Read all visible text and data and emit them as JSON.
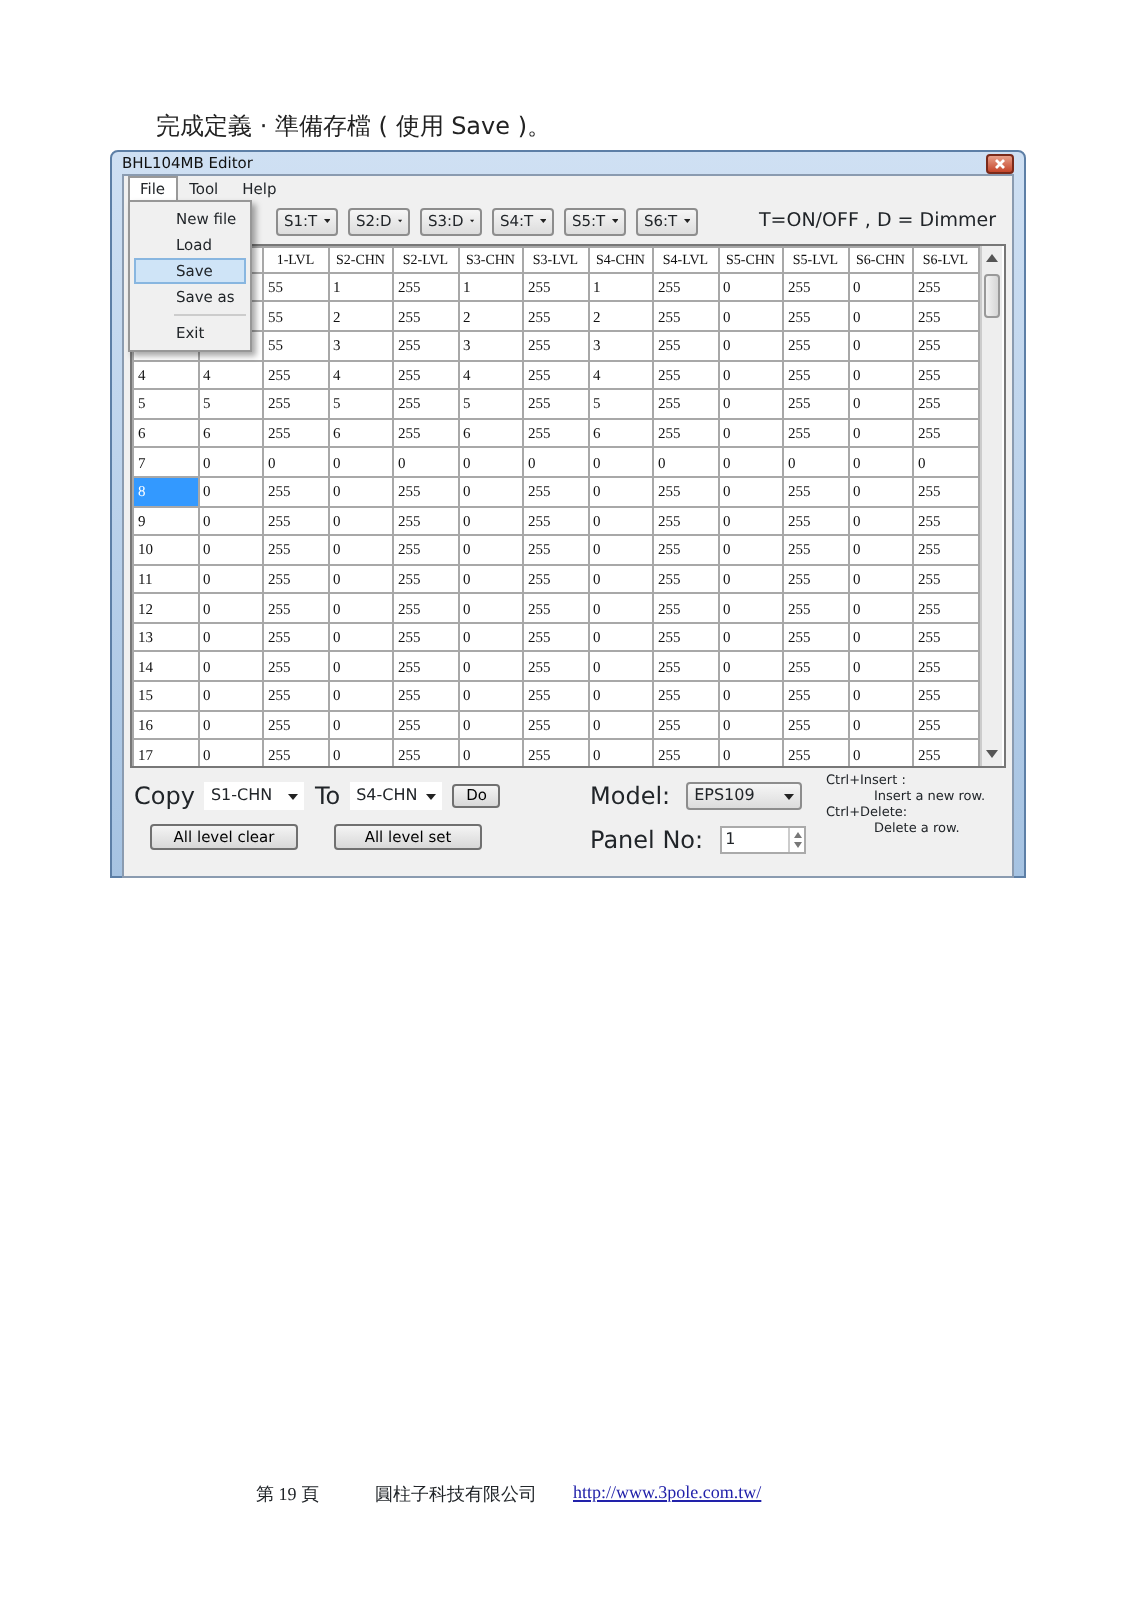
{
  "caption": "完成定義 · 準備存檔 ( 使用 Save )。",
  "window": {
    "title": "BHL104MB Editor",
    "menu": [
      {
        "label": "File",
        "selected": true
      },
      {
        "label": "Tool",
        "selected": false
      },
      {
        "label": "Help",
        "selected": false
      }
    ],
    "file_menu": [
      {
        "kind": "item",
        "label": "New file",
        "selected": false
      },
      {
        "kind": "item",
        "label": "Load",
        "selected": false
      },
      {
        "kind": "item",
        "label": "Save",
        "selected": true
      },
      {
        "kind": "item",
        "label": "Save as",
        "selected": false
      },
      {
        "kind": "separator"
      },
      {
        "kind": "item",
        "label": "Exit",
        "selected": false
      }
    ],
    "slots": [
      "S1:T",
      "S2:D",
      "S3:D",
      "S4:T",
      "S5:T",
      "S6:T"
    ],
    "legend": "T=ON/OFF , D = Dimmer",
    "table": {
      "columns": [
        null,
        null,
        "1-LVL",
        "S2-CHN",
        "S2-LVL",
        "S3-CHN",
        "S3-LVL",
        "S4-CHN",
        "S4-LVL",
        "S5-CHN",
        "S5-LVL",
        "S6-CHN",
        "S6-LVL"
      ],
      "rows": [
        {
          "selected": false,
          "cells": [
            null,
            null,
            "55",
            "1",
            "255",
            "1",
            "255",
            "1",
            "255",
            "0",
            "255",
            "0",
            "255"
          ]
        },
        {
          "selected": false,
          "cells": [
            null,
            null,
            "55",
            "2",
            "255",
            "2",
            "255",
            "2",
            "255",
            "0",
            "255",
            "0",
            "255"
          ]
        },
        {
          "selected": false,
          "cells": [
            null,
            null,
            "55",
            "3",
            "255",
            "3",
            "255",
            "3",
            "255",
            "0",
            "255",
            "0",
            "255"
          ]
        },
        {
          "selected": false,
          "cells": [
            "4",
            "4",
            "255",
            "4",
            "255",
            "4",
            "255",
            "4",
            "255",
            "0",
            "255",
            "0",
            "255"
          ]
        },
        {
          "selected": false,
          "cells": [
            "5",
            "5",
            "255",
            "5",
            "255",
            "5",
            "255",
            "5",
            "255",
            "0",
            "255",
            "0",
            "255"
          ]
        },
        {
          "selected": false,
          "cells": [
            "6",
            "6",
            "255",
            "6",
            "255",
            "6",
            "255",
            "6",
            "255",
            "0",
            "255",
            "0",
            "255"
          ]
        },
        {
          "selected": false,
          "cells": [
            "7",
            "0",
            "0",
            "0",
            "0",
            "0",
            "0",
            "0",
            "0",
            "0",
            "0",
            "0",
            "0"
          ]
        },
        {
          "selected": true,
          "cells": [
            "8",
            "0",
            "255",
            "0",
            "255",
            "0",
            "255",
            "0",
            "255",
            "0",
            "255",
            "0",
            "255"
          ]
        },
        {
          "selected": false,
          "cells": [
            "9",
            "0",
            "255",
            "0",
            "255",
            "0",
            "255",
            "0",
            "255",
            "0",
            "255",
            "0",
            "255"
          ]
        },
        {
          "selected": false,
          "cells": [
            "10",
            "0",
            "255",
            "0",
            "255",
            "0",
            "255",
            "0",
            "255",
            "0",
            "255",
            "0",
            "255"
          ]
        },
        {
          "selected": false,
          "cells": [
            "11",
            "0",
            "255",
            "0",
            "255",
            "0",
            "255",
            "0",
            "255",
            "0",
            "255",
            "0",
            "255"
          ]
        },
        {
          "selected": false,
          "cells": [
            "12",
            "0",
            "255",
            "0",
            "255",
            "0",
            "255",
            "0",
            "255",
            "0",
            "255",
            "0",
            "255"
          ]
        },
        {
          "selected": false,
          "cells": [
            "13",
            "0",
            "255",
            "0",
            "255",
            "0",
            "255",
            "0",
            "255",
            "0",
            "255",
            "0",
            "255"
          ]
        },
        {
          "selected": false,
          "cells": [
            "14",
            "0",
            "255",
            "0",
            "255",
            "0",
            "255",
            "0",
            "255",
            "0",
            "255",
            "0",
            "255"
          ]
        },
        {
          "selected": false,
          "cells": [
            "15",
            "0",
            "255",
            "0",
            "255",
            "0",
            "255",
            "0",
            "255",
            "0",
            "255",
            "0",
            "255"
          ]
        },
        {
          "selected": false,
          "cells": [
            "16",
            "0",
            "255",
            "0",
            "255",
            "0",
            "255",
            "0",
            "255",
            "0",
            "255",
            "0",
            "255"
          ]
        },
        {
          "selected": false,
          "cells": [
            "17",
            "0",
            "255",
            "0",
            "255",
            "0",
            "255",
            "0",
            "255",
            "0",
            "255",
            "0",
            "255"
          ]
        }
      ]
    },
    "copy_label": "Copy",
    "copy_from": "S1-CHN",
    "to_label": "To",
    "copy_to": "S4-CHN",
    "do_button": "Do",
    "model_label": "Model:",
    "model": "EPS109",
    "panel_label": "Panel No:",
    "panel_no": "1",
    "buttons": [
      "All level clear",
      "All level set"
    ],
    "hints": [
      {
        "key": "Ctrl+Insert :",
        "text": "Insert a new row."
      },
      {
        "key": "Ctrl+Delete:",
        "text": "Delete a row."
      }
    ]
  },
  "footer": {
    "page": "第 19 頁",
    "company": "圓柱子科技有限公司",
    "url": "http://www.3pole.com.tw/"
  }
}
